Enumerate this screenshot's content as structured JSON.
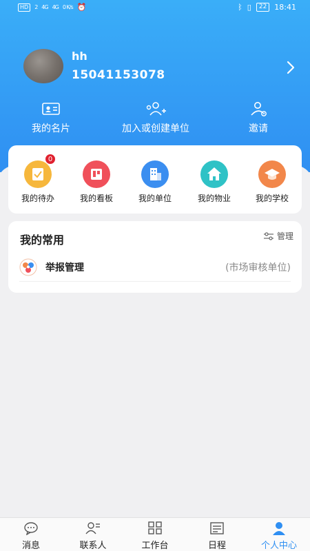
{
  "status_bar": {
    "left": [
      "HD",
      "2",
      "4G",
      "4G",
      "0 K/s"
    ],
    "battery": "22",
    "time": "18:41"
  },
  "profile": {
    "username": "hh",
    "phone": "15041153078"
  },
  "quick_actions": [
    {
      "label": "我的名片",
      "icon": "id-card-icon"
    },
    {
      "label": "加入或创建单位",
      "icon": "add-users-icon"
    },
    {
      "label": "邀请",
      "icon": "invite-user-icon"
    }
  ],
  "shortcuts": [
    {
      "label": "我的待办",
      "icon": "todo-icon",
      "color": "#f6b73c",
      "badge": "0"
    },
    {
      "label": "我的看板",
      "icon": "board-icon",
      "color": "#f0505a"
    },
    {
      "label": "我的单位",
      "icon": "building-icon",
      "color": "#3b8ef0"
    },
    {
      "label": "我的物业",
      "icon": "home-icon",
      "color": "#2fc2c6"
    },
    {
      "label": "我的学校",
      "icon": "graduation-cap-icon",
      "color": "#f2874a"
    }
  ],
  "common": {
    "title": "我的常用",
    "manage_label": "管理",
    "items": [
      {
        "name": "举报管理",
        "sub": "(市场审核单位)"
      }
    ]
  },
  "tabs": [
    {
      "label": "消息",
      "icon": "chat-icon",
      "active": false
    },
    {
      "label": "联系人",
      "icon": "contacts-icon",
      "active": false
    },
    {
      "label": "工作台",
      "icon": "grid-icon",
      "active": false
    },
    {
      "label": "日程",
      "icon": "calendar-icon",
      "active": false
    },
    {
      "label": "个人中心",
      "icon": "person-icon",
      "active": true
    }
  ],
  "colors": {
    "header_top": "#3aaef8",
    "header_bottom": "#2f8ff2",
    "accent": "#2f8ff2",
    "badge": "#e0212f"
  }
}
